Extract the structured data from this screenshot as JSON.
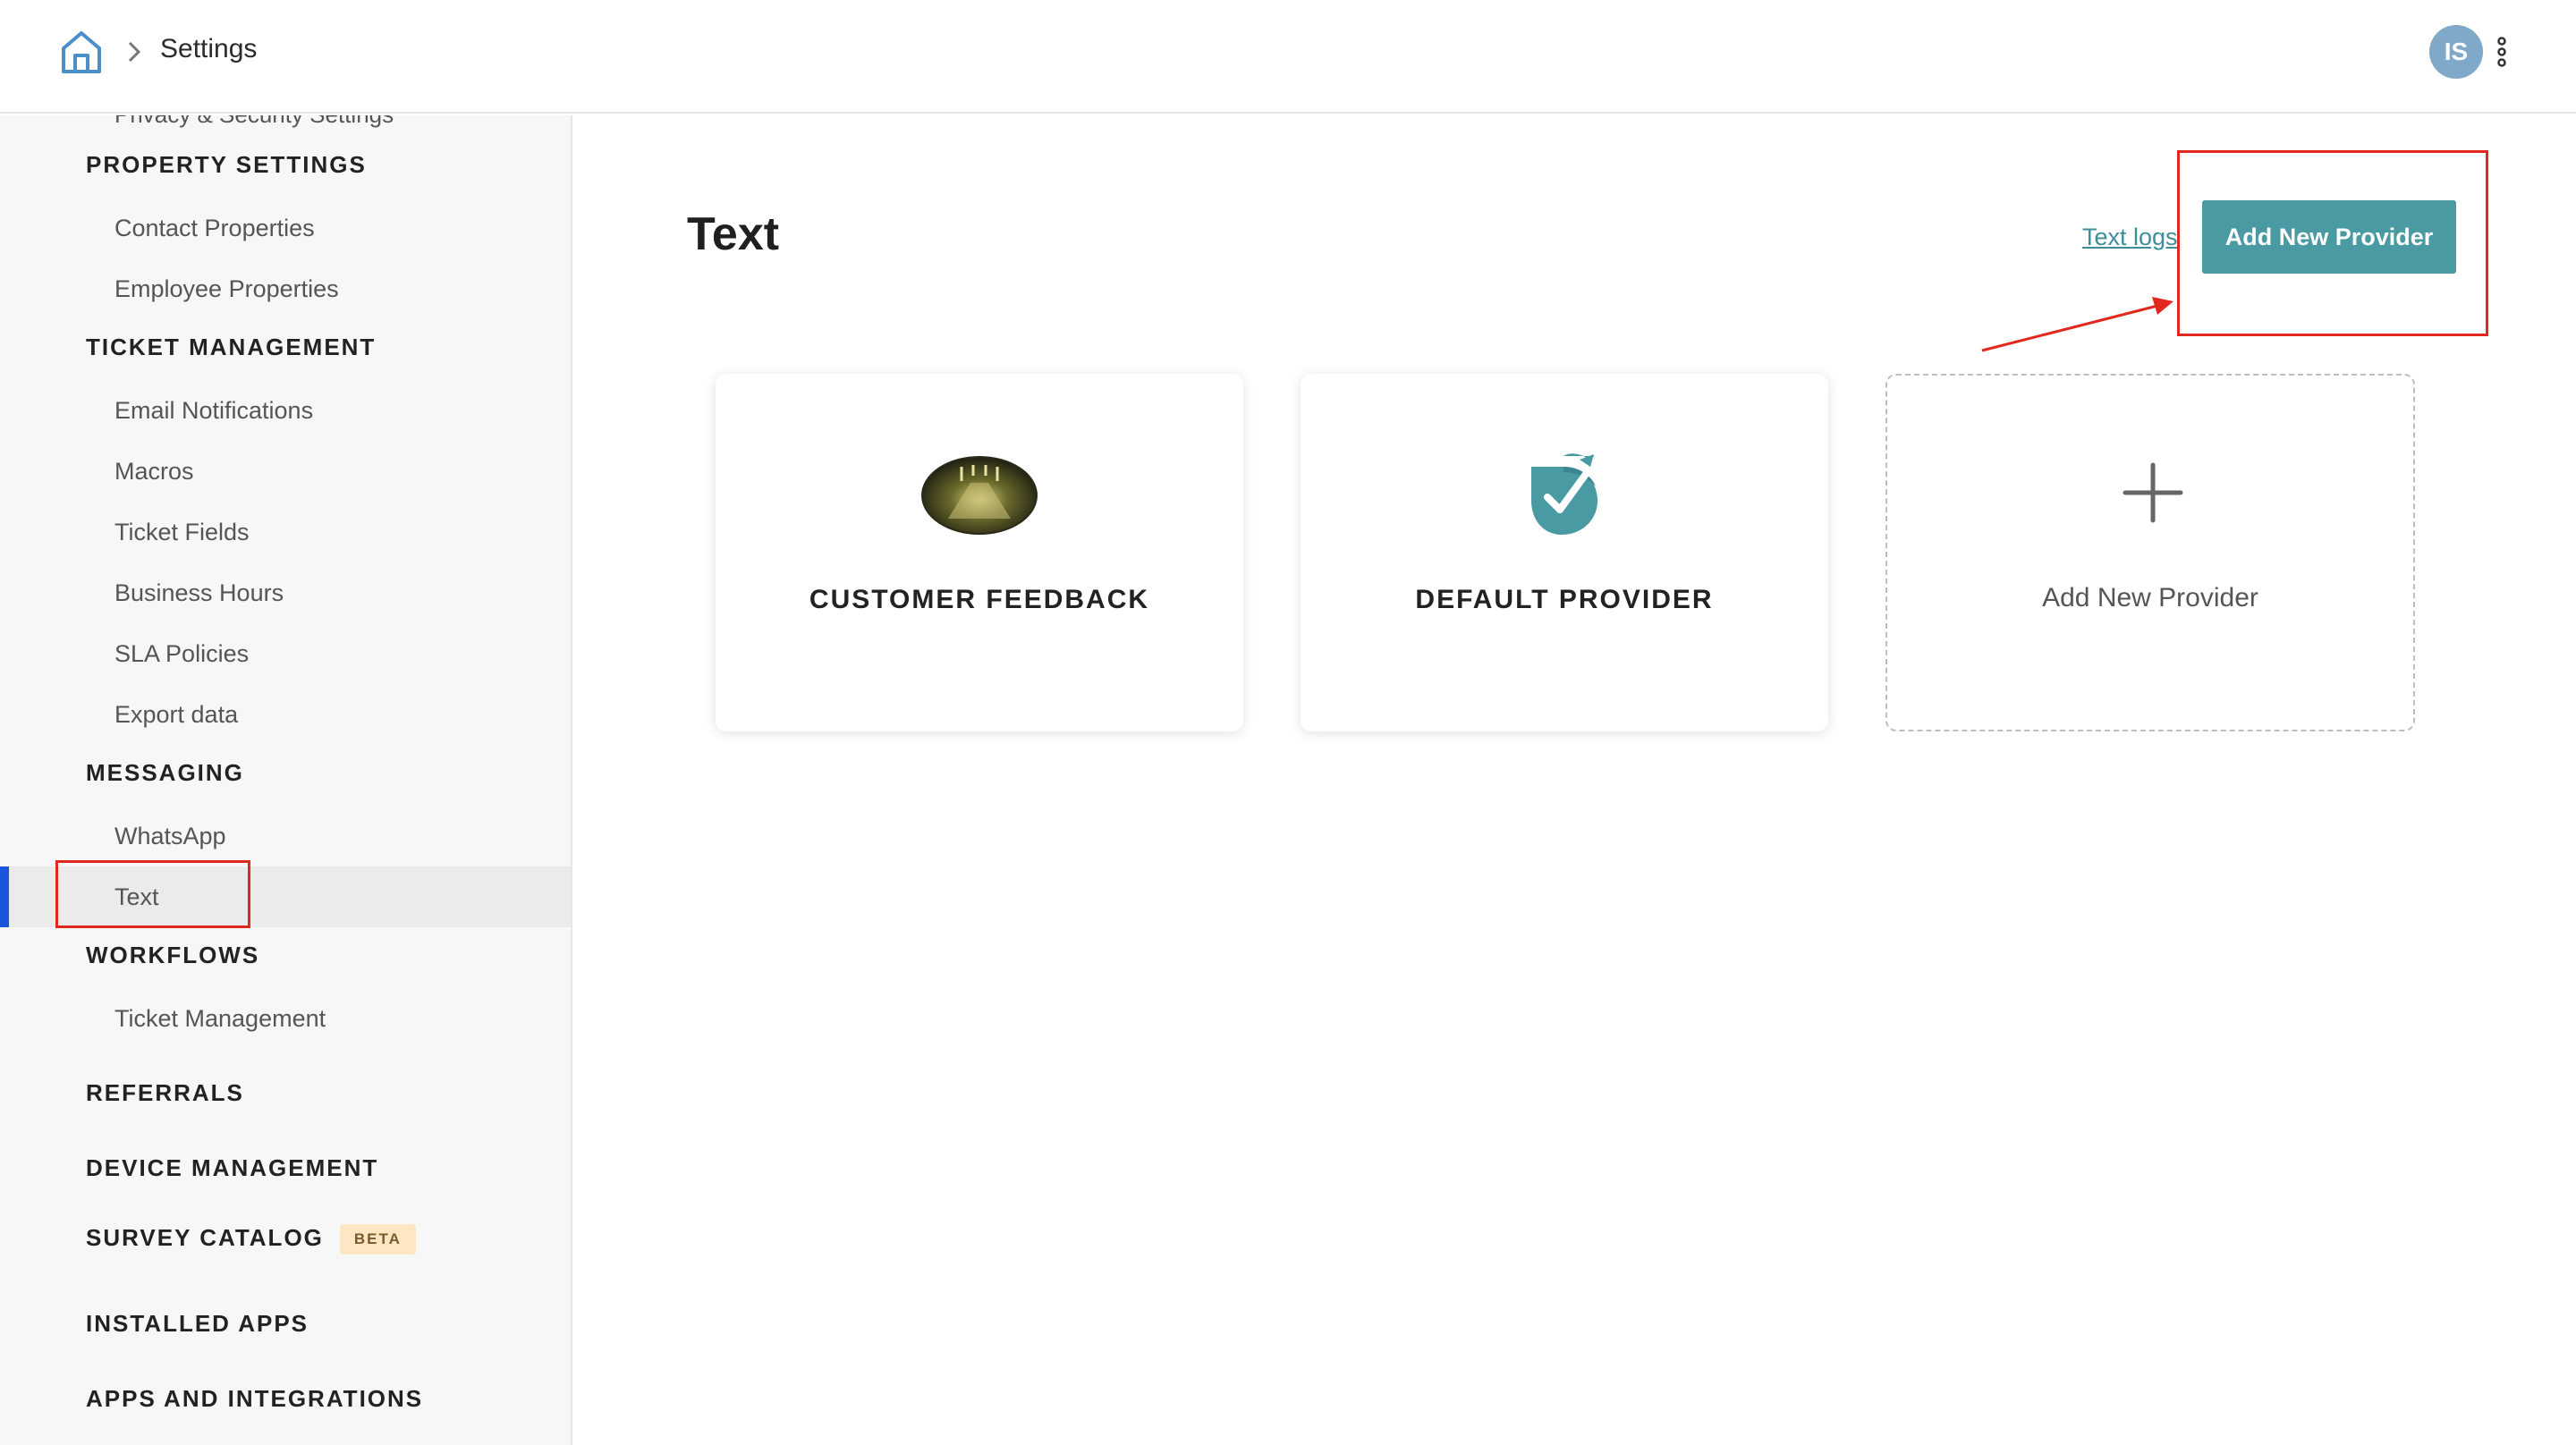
{
  "header": {
    "breadcrumb_title": "Settings",
    "avatar_initials": "IS",
    "home_icon": "home-icon",
    "menu_icon": "kebab-menu-icon"
  },
  "sidebar": {
    "cut_off_item": "Privacy & Security Settings",
    "sections": [
      {
        "label": "PROPERTY SETTINGS",
        "items": [
          "Contact Properties",
          "Employee Properties"
        ]
      },
      {
        "label": "TICKET MANAGEMENT",
        "items": [
          "Email Notifications",
          "Macros",
          "Ticket Fields",
          "Business Hours",
          "SLA Policies",
          "Export data"
        ]
      },
      {
        "label": "MESSAGING",
        "items": [
          "WhatsApp",
          "Text"
        ]
      },
      {
        "label": "WORKFLOWS",
        "items": [
          "Ticket Management"
        ]
      },
      {
        "label": "REFERRALS",
        "items": []
      },
      {
        "label": "DEVICE MANAGEMENT",
        "items": []
      },
      {
        "label": "SURVEY CATALOG",
        "badge": "BETA",
        "items": []
      },
      {
        "label": "INSTALLED APPS",
        "items": []
      },
      {
        "label": "APPS AND INTEGRATIONS",
        "items": []
      }
    ],
    "active_item": "Text"
  },
  "main": {
    "title": "Text",
    "text_logs_link": "Text logs",
    "add_provider_button": "Add New Provider",
    "cards": [
      {
        "label": "CUSTOMER FEEDBACK",
        "icon": "customer-feedback-image"
      },
      {
        "label": "DEFAULT PROVIDER",
        "icon": "shield-check-icon"
      },
      {
        "label": "Add New Provider",
        "icon": "plus-icon"
      }
    ]
  },
  "colors": {
    "accent": "#4a9aa3",
    "link": "#3c8e98",
    "active_indicator": "#1a56db",
    "annotation": "#e0281e",
    "avatar_bg": "#7fa8c9",
    "beta_badge_bg": "#fde6c3"
  }
}
